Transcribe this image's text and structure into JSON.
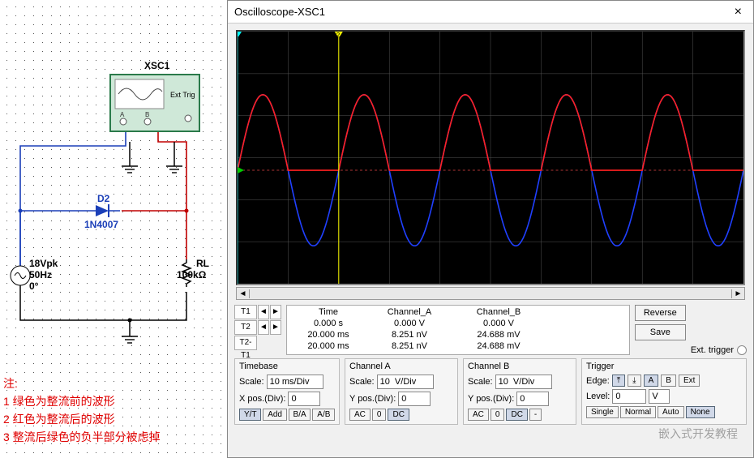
{
  "schematic": {
    "scope_ref": "XSC1",
    "scope_ext": "Ext Trig",
    "scope_a": "A",
    "scope_b": "B",
    "diode_ref": "D2",
    "diode_part": "1N4007",
    "src_v": "18Vpk",
    "src_f": "50Hz",
    "src_ph": "0°",
    "rl_ref": "RL",
    "rl_val": "100kΩ",
    "note_title": "注:",
    "note1": "1 绿色为整流前的波形",
    "note2": "2 红色为整流后的波形",
    "note3": "3 整流后绿色的负半部分被虑掉"
  },
  "osc": {
    "title": "Oscilloscope-XSC1",
    "cursors": {
      "headers": {
        "time": "Time",
        "cha": "Channel_A",
        "chb": "Channel_B"
      },
      "T1": {
        "label": "T1",
        "time": "0.000 s",
        "cha": "0.000 V",
        "chb": "0.000 V"
      },
      "T2": {
        "label": "T2",
        "time": "20.000 ms",
        "cha": "8.251 nV",
        "chb": "24.688 mV"
      },
      "diff": {
        "label": "T2-T1",
        "time": "20.000 ms",
        "cha": "8.251 nV",
        "chb": "24.688 mV"
      }
    },
    "reverse": "Reverse",
    "save": "Save",
    "ext_trigger": "Ext. trigger",
    "timebase": {
      "title": "Timebase",
      "scale_label": "Scale:",
      "scale": "10 ms/Div",
      "xpos_label": "X pos.(Div):",
      "xpos": "0",
      "btn_yt": "Y/T",
      "btn_add": "Add",
      "btn_ba": "B/A",
      "btn_ab": "A/B"
    },
    "cha": {
      "title": "Channel A",
      "scale_label": "Scale:",
      "scale": "10  V/Div",
      "ypos_label": "Y pos.(Div):",
      "ypos": "0",
      "btn_ac": "AC",
      "btn_0": "0",
      "btn_dc": "DC"
    },
    "chb": {
      "title": "Channel B",
      "scale_label": "Scale:",
      "scale": "10  V/Div",
      "ypos_label": "Y pos.(Div):",
      "ypos": "0",
      "btn_ac": "AC",
      "btn_0": "0",
      "btn_dc": "DC",
      "btn_minus": "-"
    },
    "trigger": {
      "title": "Trigger",
      "edge_label": "Edge:",
      "level_label": "Level:",
      "level": "0",
      "level_unit": "V",
      "btn_a": "A",
      "btn_b": "B",
      "btn_ext": "Ext",
      "btn_single": "Single",
      "btn_normal": "Normal",
      "btn_auto": "Auto",
      "btn_none": "None"
    }
  },
  "chart_data": {
    "type": "line",
    "x_range_ms": [
      0,
      100
    ],
    "y_range_v": [
      -30,
      30
    ],
    "x_divisions": 10,
    "y_divisions": 6,
    "cursors": {
      "T1_ms": 0,
      "T2_ms": 20
    },
    "series": [
      {
        "name": "Channel_A_blue",
        "color": "#2040ff",
        "function": "18*sin(2*pi*50*t)",
        "amplitude_v": 18,
        "freq_hz": 50
      },
      {
        "name": "Channel_B_red",
        "color": "#ff2020",
        "function": "max(0, 18*sin(2*pi*50*t))",
        "amplitude_v": 18,
        "freq_hz": 50
      }
    ]
  },
  "watermark": "嵌入式开发教程"
}
